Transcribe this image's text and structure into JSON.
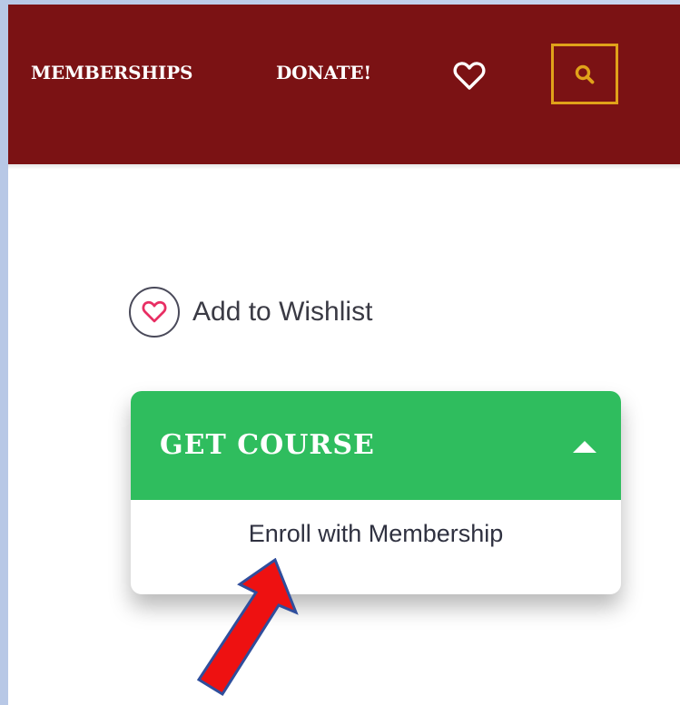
{
  "header": {
    "nav": {
      "memberships": "MEMBERSHIPS",
      "donate": "DONATE!"
    },
    "icons": {
      "wishlist": "heart-outline-icon",
      "search": "search-icon"
    }
  },
  "wishlist": {
    "label": "Add to Wishlist",
    "icon": "heart-outline-icon"
  },
  "course": {
    "get_course_label": "GET COURSE",
    "caret_icon": "caret-up-icon",
    "options": [
      "Enroll with Membership"
    ]
  },
  "annotation": {
    "arrow_icon": "red-arrow-pointer"
  },
  "colors": {
    "header_bg": "#7b1214",
    "search_border": "#e0a21a",
    "get_course_bg": "#2fbd5e",
    "arrow_fill": "#ee1111",
    "arrow_stroke": "#2f4e9c",
    "heart_pink": "#e82e63"
  }
}
